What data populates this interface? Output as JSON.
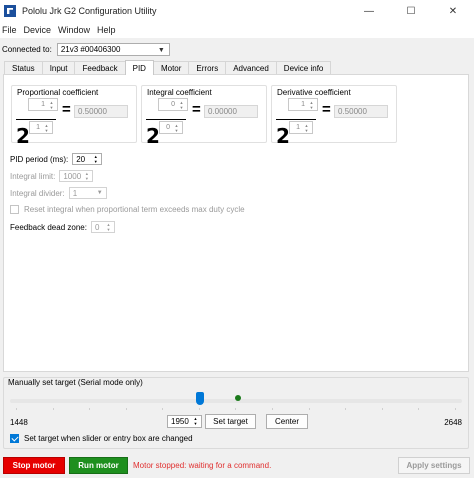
{
  "window": {
    "title": "Pololu Jrk G2 Configuration Utility",
    "minimize_glyph": "—",
    "maximize_glyph": "☐",
    "close_glyph": "✕"
  },
  "menu": [
    "File",
    "Device",
    "Window",
    "Help"
  ],
  "connection": {
    "label": "Connected to:",
    "device": "21v3 #00406300"
  },
  "tabs": [
    "Status",
    "Input",
    "Feedback",
    "PID",
    "Motor",
    "Errors",
    "Advanced",
    "Device info"
  ],
  "active_tab": "PID",
  "pid": {
    "proportional": {
      "title": "Proportional coefficient",
      "multiplier": "1",
      "exponent": "1",
      "base": "2",
      "equals": "=",
      "value": "0.50000"
    },
    "integral": {
      "title": "Integral coefficient",
      "multiplier": "0",
      "exponent": "0",
      "base": "2",
      "equals": "=",
      "value": "0.00000"
    },
    "derivative": {
      "title": "Derivative coefficient",
      "multiplier": "1",
      "exponent": "1",
      "base": "2",
      "equals": "=",
      "value": "0.50000"
    },
    "pid_period": {
      "label": "PID period (ms):",
      "value": "20"
    },
    "integral_limit": {
      "label": "Integral limit:",
      "value": "1000"
    },
    "integral_divider": {
      "label": "Integral divider:",
      "value": "1"
    },
    "reset_integral": {
      "label": "Reset integral when proportional term exceeds max duty cycle",
      "checked": false
    },
    "feedback_dead_zone": {
      "label": "Feedback dead zone:",
      "value": "0"
    }
  },
  "manual_target": {
    "title": "Manually set target (Serial mode only)",
    "min": "1448",
    "max": "2648",
    "target_value": "1950",
    "slider_value": 1950,
    "current_target_marker": 2074,
    "set_target_label": "Set target",
    "center_label": "Center",
    "auto_set_label": "Set target when slider or entry box are changed",
    "auto_set_checked": true
  },
  "footer": {
    "stop_label": "Stop motor",
    "run_label": "Run motor",
    "status": "Motor stopped: waiting for a command.",
    "apply_label": "Apply settings"
  },
  "colors": {
    "stop": "#e60000",
    "run": "#1e8f1e",
    "status_text": "#e03030",
    "accent": "#0078d7"
  }
}
